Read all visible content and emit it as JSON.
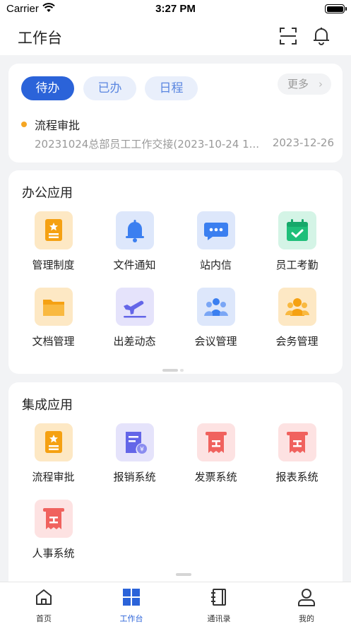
{
  "status_bar": {
    "carrier": "Carrier",
    "time": "3:27 PM"
  },
  "header": {
    "title": "工作台"
  },
  "todo": {
    "tabs": [
      "待办",
      "已办",
      "日程"
    ],
    "more_label": "更多",
    "item": {
      "title": "流程审批",
      "description": "20231024总部员工工作交接(2023-10-24 1...",
      "date": "2023-12-26"
    }
  },
  "office": {
    "title": "办公应用",
    "apps": [
      {
        "label": "管理制度",
        "icon": "badge-doc-icon"
      },
      {
        "label": "文件通知",
        "icon": "bell-icon"
      },
      {
        "label": "站内信",
        "icon": "chat-icon"
      },
      {
        "label": "员工考勤",
        "icon": "calendar-check-icon"
      },
      {
        "label": "文档管理",
        "icon": "folder-icon"
      },
      {
        "label": "出差动态",
        "icon": "airplane-icon"
      },
      {
        "label": "会议管理",
        "icon": "group-icon"
      },
      {
        "label": "会务管理",
        "icon": "people-icon"
      }
    ]
  },
  "integrated": {
    "title": "集成应用",
    "apps": [
      {
        "label": "流程审批",
        "icon": "badge-doc-icon"
      },
      {
        "label": "报销系统",
        "icon": "receipt-yen-icon"
      },
      {
        "label": "发票系统",
        "icon": "invoice-icon"
      },
      {
        "label": "报表系统",
        "icon": "invoice-icon"
      },
      {
        "label": "人事系统",
        "icon": "invoice-icon"
      }
    ]
  },
  "tabbar": {
    "items": [
      {
        "label": "首页",
        "icon": "home-icon"
      },
      {
        "label": "工作台",
        "icon": "grid-icon"
      },
      {
        "label": "通讯录",
        "icon": "contacts-icon"
      },
      {
        "label": "我的",
        "icon": "user-icon"
      }
    ],
    "active_index": 1
  },
  "colors": {
    "primary": "#2b63d9",
    "accent_dot": "#f5a623"
  }
}
